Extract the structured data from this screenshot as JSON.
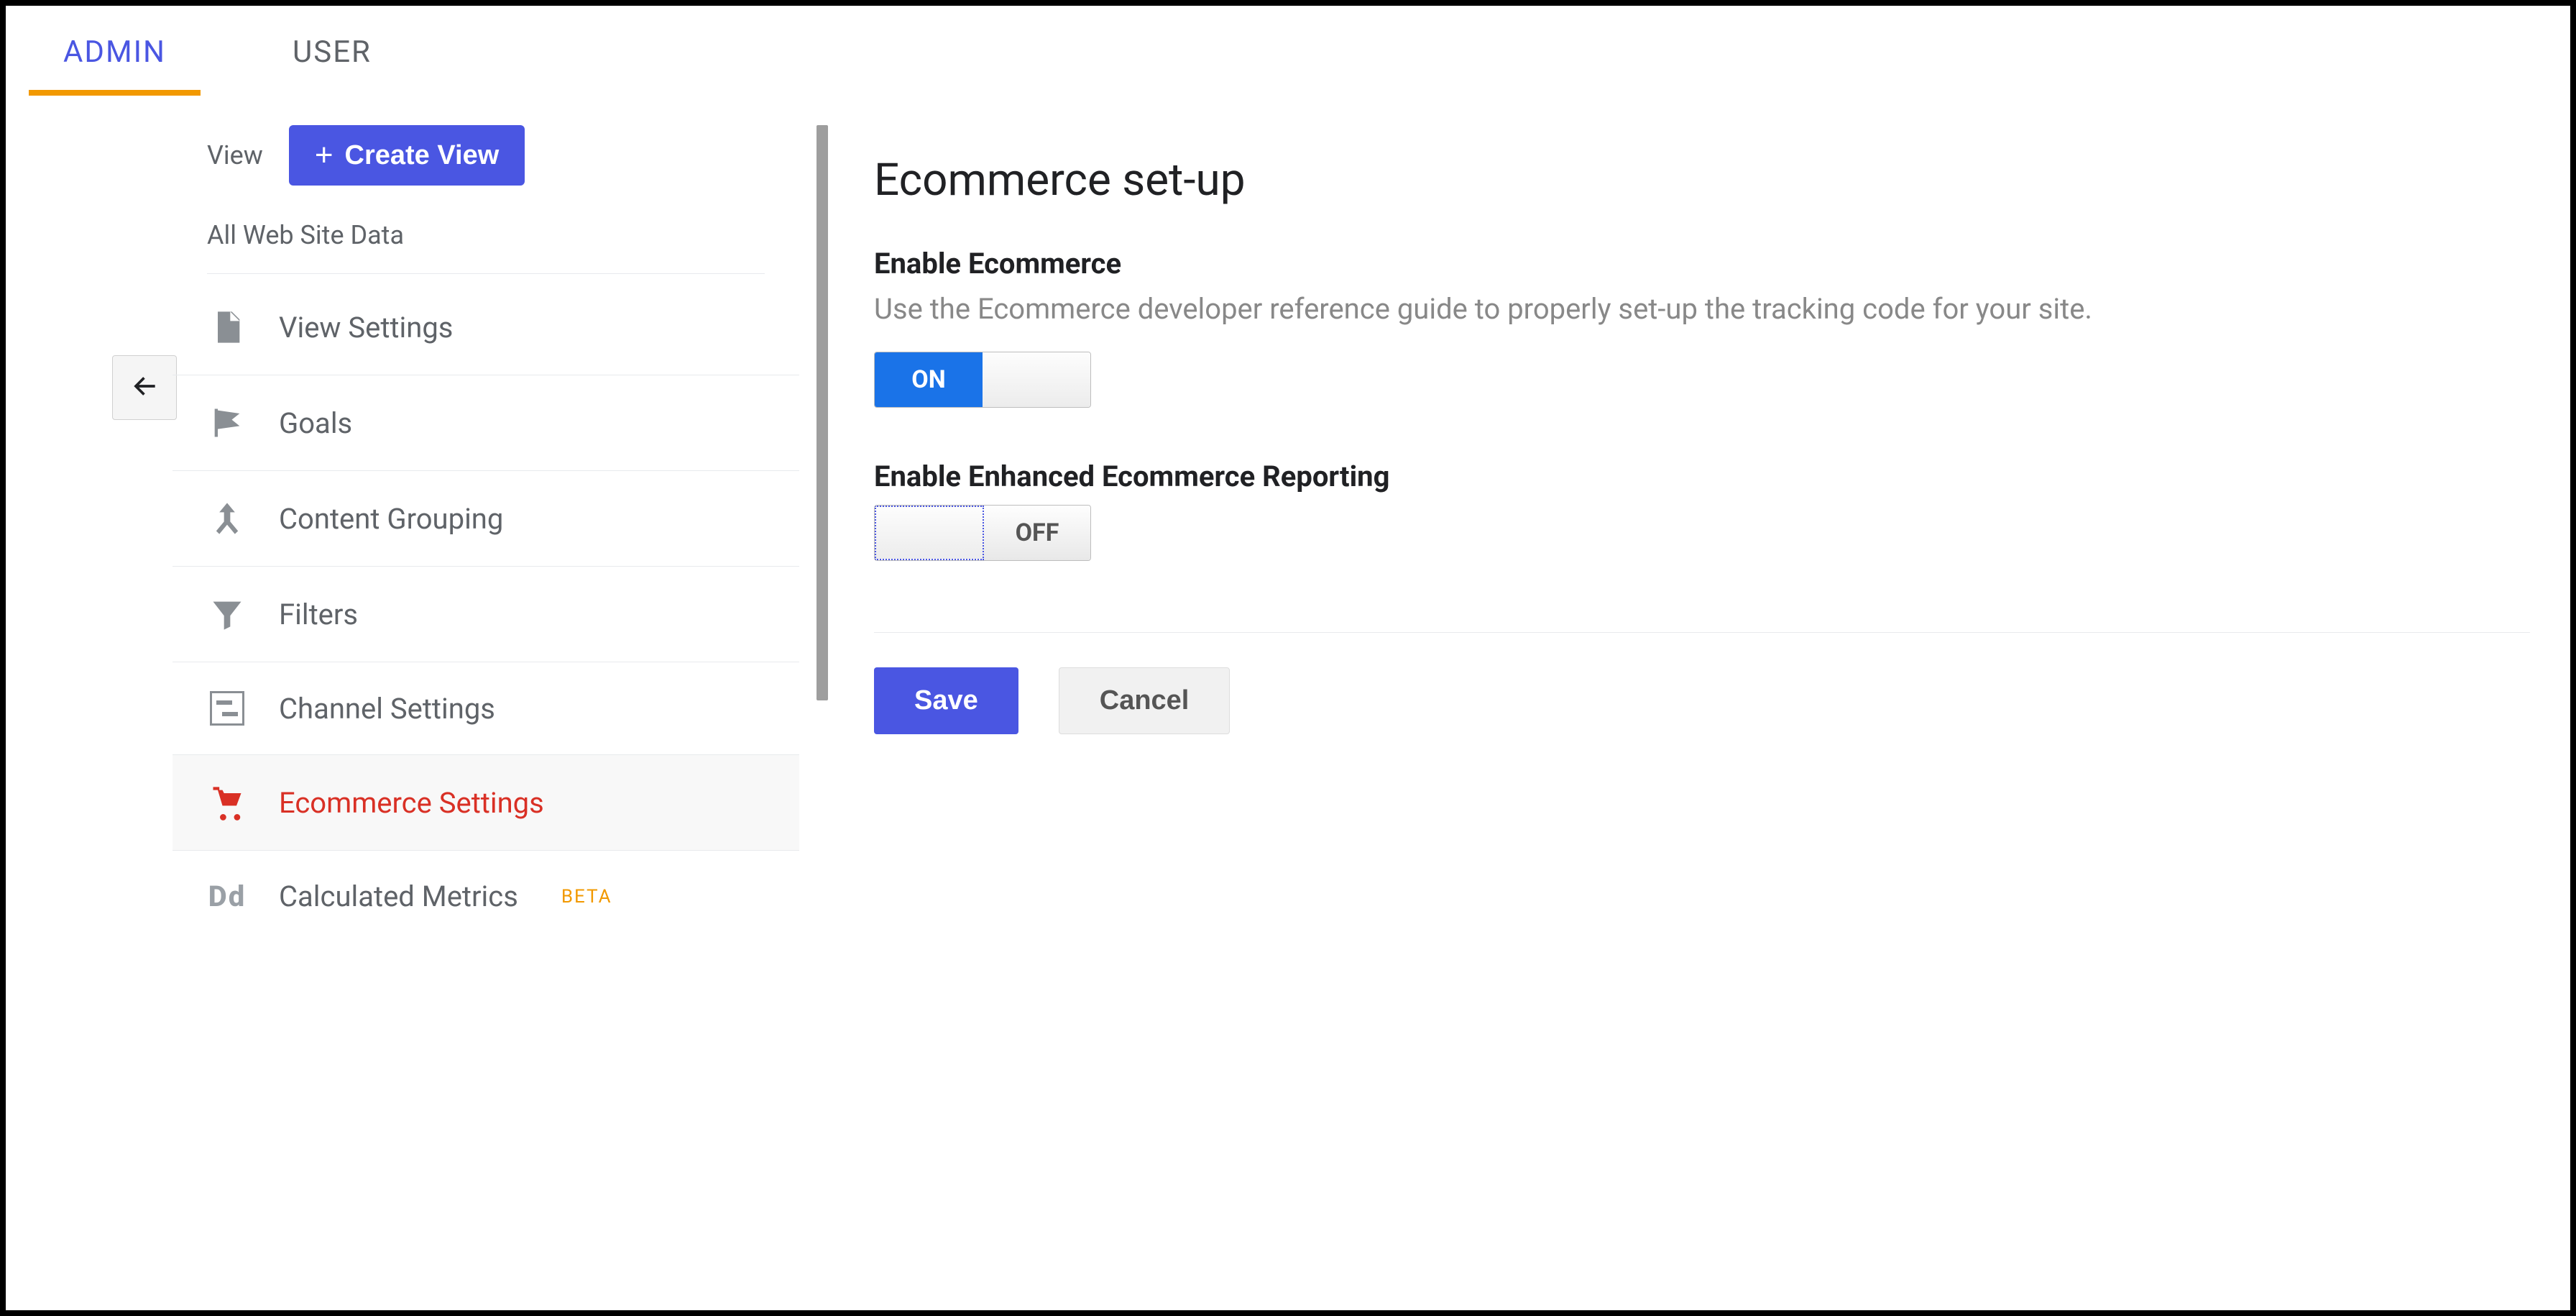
{
  "tabs": {
    "admin": "ADMIN",
    "user": "USER"
  },
  "sidebar": {
    "view_label": "View",
    "create_view_label": "Create View",
    "source_name": "All Web Site Data",
    "items": [
      {
        "label": "View Settings"
      },
      {
        "label": "Goals"
      },
      {
        "label": "Content Grouping"
      },
      {
        "label": "Filters"
      },
      {
        "label": "Channel Settings"
      },
      {
        "label": "Ecommerce Settings"
      },
      {
        "label": "Calculated Metrics",
        "badge": "BETA"
      }
    ]
  },
  "main": {
    "title": "Ecommerce set-up",
    "section1": {
      "title": "Enable Ecommerce",
      "desc": "Use the Ecommerce developer reference guide to properly set-up the tracking code for your site.",
      "toggle": "ON"
    },
    "section2": {
      "title": "Enable Enhanced Ecommerce Reporting",
      "toggle": "OFF"
    },
    "save": "Save",
    "cancel": "Cancel"
  }
}
